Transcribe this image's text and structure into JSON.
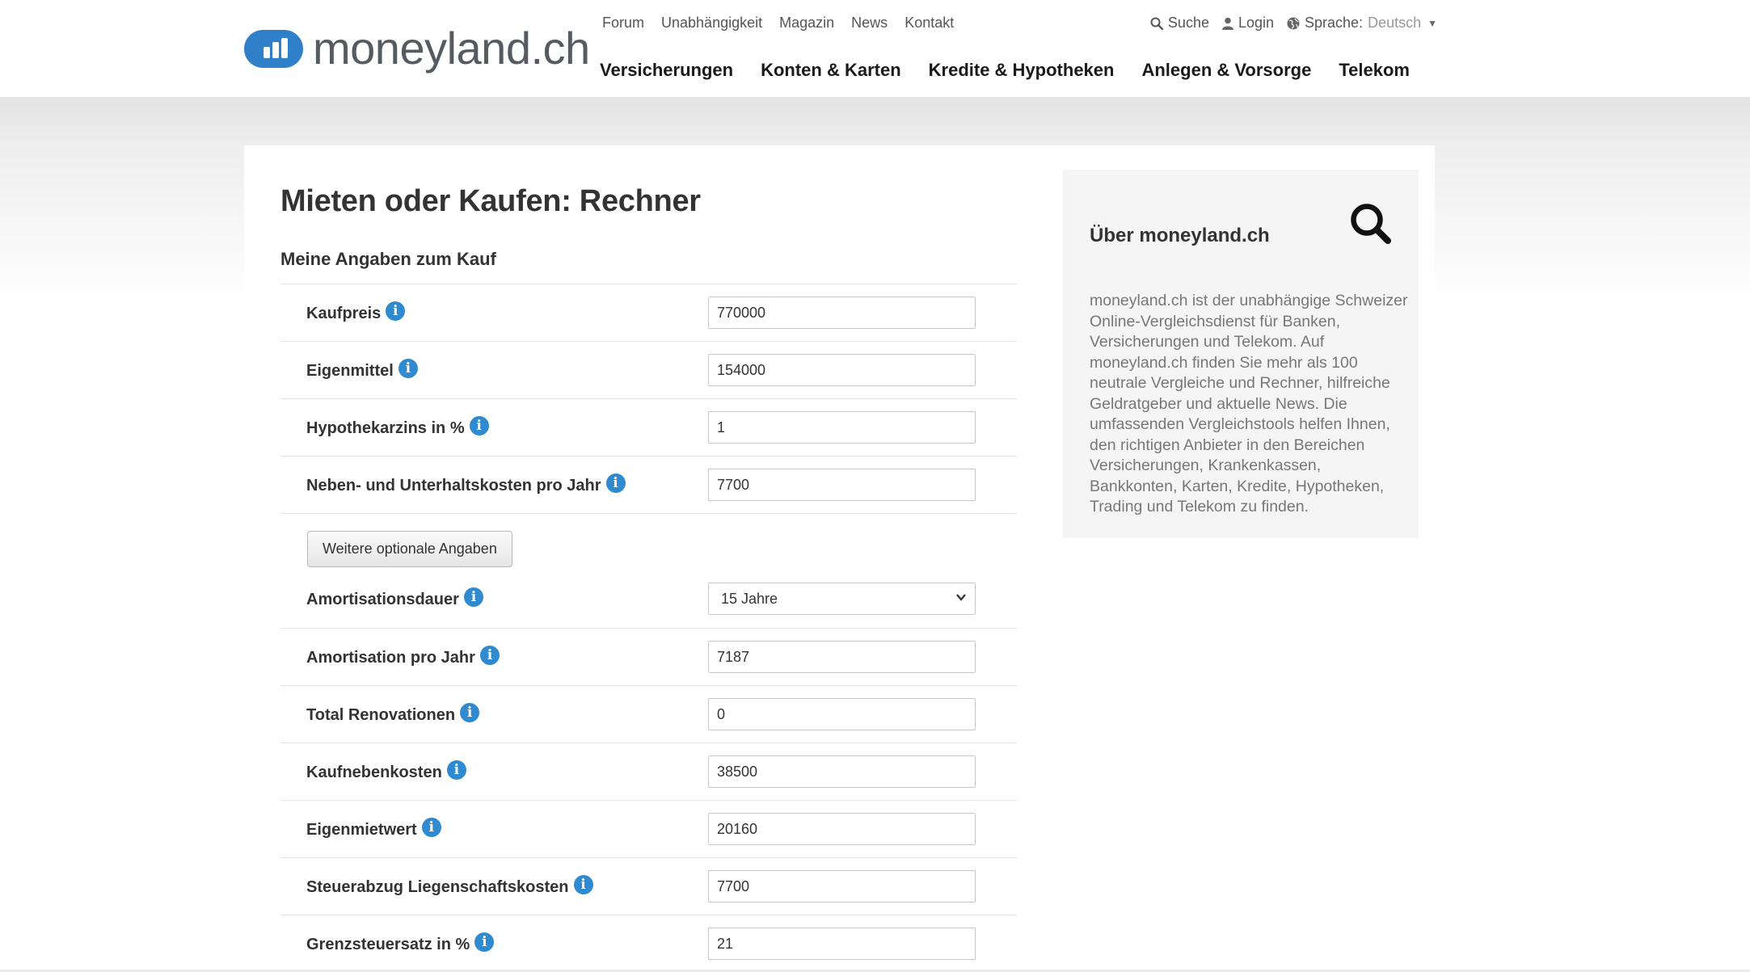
{
  "brand": {
    "logo_text": "moneyland.ch",
    "accent": "#2f7fc9"
  },
  "meta_nav": [
    "Forum",
    "Unabhängigkeit",
    "Magazin",
    "News",
    "Kontakt"
  ],
  "utility": {
    "search": "Suche",
    "login": "Login",
    "language_label": "Sprache:",
    "language_value": "Deutsch"
  },
  "main_nav": [
    "Versicherungen",
    "Konten & Karten",
    "Kredite & Hypotheken",
    "Anlegen & Vorsorge",
    "Telekom"
  ],
  "page": {
    "title": "Mieten oder Kaufen: Rechner",
    "section_title": "Meine Angaben zum Kauf"
  },
  "form": {
    "kaufpreis": {
      "label": "Kaufpreis",
      "value": "770000"
    },
    "eigenmittel": {
      "label": "Eigenmittel",
      "value": "154000"
    },
    "hypothekarzins": {
      "label": "Hypothekarzins in %",
      "value": "1"
    },
    "nebenkosten": {
      "label": "Neben- und Unterhaltskosten pro Jahr",
      "value": "7700"
    },
    "optional_button": "Weitere optionale Angaben",
    "amortisationsdauer": {
      "label": "Amortisationsdauer",
      "value": "15 Jahre"
    },
    "amortisation_jahr": {
      "label": "Amortisation pro Jahr",
      "value": "7187"
    },
    "renovationen": {
      "label": "Total Renovationen",
      "value": "0"
    },
    "kaufnebenkosten": {
      "label": "Kaufnebenkosten",
      "value": "38500"
    },
    "eigenmietwert": {
      "label": "Eigenmietwert",
      "value": "20160"
    },
    "steuerabzug": {
      "label": "Steuerabzug Liegenschaftskosten",
      "value": "7700"
    },
    "grenzsteuersatz": {
      "label": "Grenzsteuersatz in %",
      "value": "21"
    }
  },
  "sidebar": {
    "title": "Über moneyland.ch",
    "text": "moneyland.ch ist der unabhängige Schweizer Online-Vergleichsdienst für Banken, Versicherungen und Telekom. Auf moneyland.ch finden Sie mehr als 100 neutrale Vergleiche und Rechner, hilfreiche Geldratgeber und aktuelle News. Die umfassenden Vergleichstools helfen Ihnen, den richtigen Anbieter in den Bereichen Versicherungen, Krankenkassen, Bankkonten, Karten, Kredite, Hypotheken, Trading und Telekom zu finden."
  }
}
